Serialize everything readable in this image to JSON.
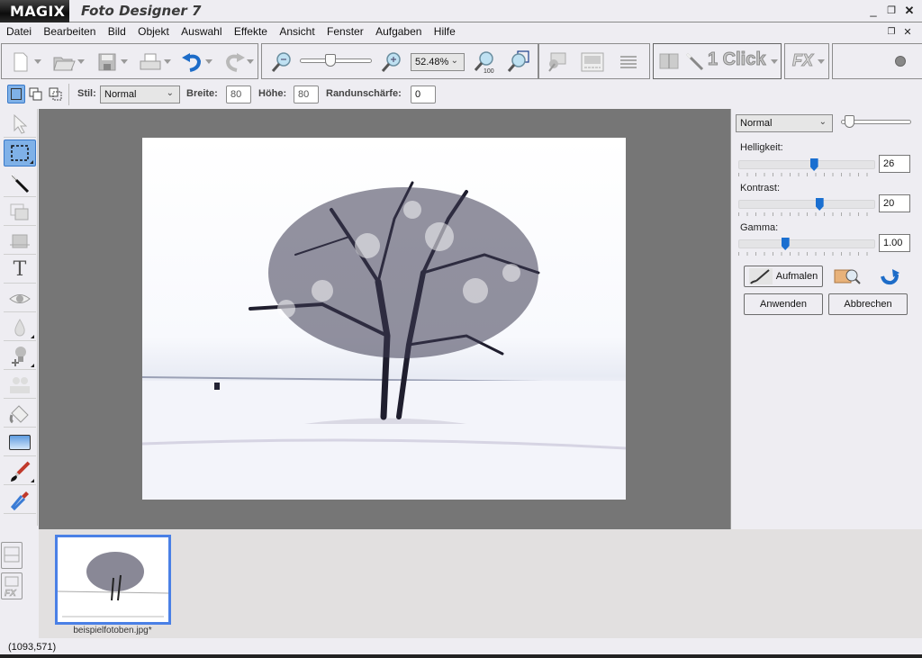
{
  "app": {
    "brand": "MAGIX",
    "title": "Foto Designer 7",
    "window_controls": [
      "minimize",
      "restore",
      "close"
    ],
    "doc_controls": [
      "restore",
      "close"
    ]
  },
  "menu": [
    "Datei",
    "Bearbeiten",
    "Bild",
    "Objekt",
    "Auswahl",
    "Effekte",
    "Ansicht",
    "Fenster",
    "Aufgaben",
    "Hilfe"
  ],
  "toolbar": {
    "buttons": [
      {
        "name": "new-document",
        "icon": "new-document-icon"
      },
      {
        "name": "open",
        "icon": "open-folder-icon"
      },
      {
        "name": "save",
        "icon": "save-icon"
      },
      {
        "name": "print",
        "icon": "print-icon"
      },
      {
        "name": "undo",
        "icon": "undo-icon"
      },
      {
        "name": "redo",
        "icon": "redo-icon"
      },
      {
        "name": "zoom-out",
        "icon": "zoom-out-icon"
      },
      {
        "name": "zoom-in",
        "icon": "zoom-in-icon"
      },
      {
        "name": "zoom-100",
        "icon": "zoom-100-icon"
      },
      {
        "name": "zoom-fit",
        "icon": "zoom-fit-icon"
      },
      {
        "name": "photo-edit",
        "icon": "photo-edit-icon"
      },
      {
        "name": "slideshow",
        "icon": "slideshow-icon"
      },
      {
        "name": "layers",
        "icon": "layers-icon"
      },
      {
        "name": "fx",
        "icon": "fx-icon"
      },
      {
        "name": "help",
        "icon": "help-icon"
      }
    ],
    "zoom_value": "52.48%",
    "zoom_slider_fraction": 0.4,
    "one_click_label": "1 Click",
    "fx_label": "FX"
  },
  "options": {
    "stil_label": "Stil:",
    "stil_value": "Normal",
    "breite_label": "Breite:",
    "breite_value": "80",
    "hoehe_label": "Höhe:",
    "hoehe_value": "80",
    "rand_label": "Randunschärfe:",
    "rand_value": "0"
  },
  "tools": [
    {
      "name": "select-arrow",
      "icon": "arrow-pointer-icon"
    },
    {
      "name": "rectangle-selection",
      "icon": "marquee-icon",
      "active": true
    },
    {
      "name": "magic-wand",
      "icon": "magic-wand-icon"
    },
    {
      "name": "object-duplicate",
      "icon": "duplicate-icon"
    },
    {
      "name": "crop",
      "icon": "crop-icon"
    },
    {
      "name": "text",
      "icon": "text-icon"
    },
    {
      "name": "red-eye",
      "icon": "eye-icon"
    },
    {
      "name": "blur",
      "icon": "drop-icon"
    },
    {
      "name": "clone-stamp",
      "icon": "stamp-icon"
    },
    {
      "name": "retouch",
      "icon": "retouch-icon"
    },
    {
      "name": "fill",
      "icon": "paint-bucket-icon"
    },
    {
      "name": "gradient",
      "icon": "gradient-icon"
    },
    {
      "name": "brush",
      "icon": "brush-icon"
    },
    {
      "name": "color-picker",
      "icon": "eyedropper-icon"
    }
  ],
  "panel": {
    "blend_mode": "Normal",
    "opacity_fraction": 0.05,
    "sliders": [
      {
        "label": "Helligkeit:",
        "value": "26",
        "fraction": 0.55
      },
      {
        "label": "Kontrast:",
        "value": "20",
        "fraction": 0.59
      },
      {
        "label": "Gamma:",
        "value": "1.00",
        "fraction": 0.34
      }
    ],
    "aufmalen_label": "Aufmalen",
    "apply_label": "Anwenden",
    "cancel_label": "Abbrechen"
  },
  "filmstrip": {
    "items": [
      {
        "name": "beispielfotoben.jpg*",
        "selected": true
      }
    ]
  },
  "status": {
    "coords": "(1093,571)"
  }
}
